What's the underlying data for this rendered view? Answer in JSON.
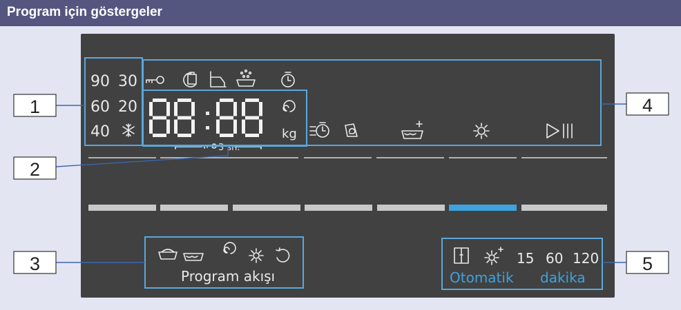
{
  "header": {
    "title": "Program için göstergeler"
  },
  "temperatures": [
    "90",
    "30",
    "60",
    "20",
    "40"
  ],
  "display": {
    "digits": "88:88",
    "unit": "kg",
    "hold_time": "3 sn."
  },
  "program_flow": {
    "label": "Program akışı"
  },
  "options": {
    "numbers": [
      "15",
      "60",
      "120"
    ],
    "left_label": "Otomatik",
    "right_label": "dakika"
  },
  "callouts": [
    "1",
    "2",
    "3",
    "4",
    "5"
  ],
  "selection_bar": {
    "selected_index": 5,
    "count": 7
  },
  "colors": {
    "header": "#55567f",
    "panel": "#414141",
    "accent": "#3ea3de",
    "bar": "#c8c8c8"
  },
  "icons": [
    "snowflake-icon",
    "key-lock-icon",
    "stain-icon",
    "rinse-hold-icon",
    "prewash-icon",
    "timer-icon",
    "spin-icon",
    "speed-timer-icon",
    "eco-icon",
    "add-detergent-icon",
    "dry-icon",
    "start-pause-icon",
    "prewash-flow-icon",
    "wash-icon",
    "spin-flow-icon",
    "dry-flow-icon",
    "cycle-icon",
    "door-icon",
    "dry-plus-icon"
  ]
}
